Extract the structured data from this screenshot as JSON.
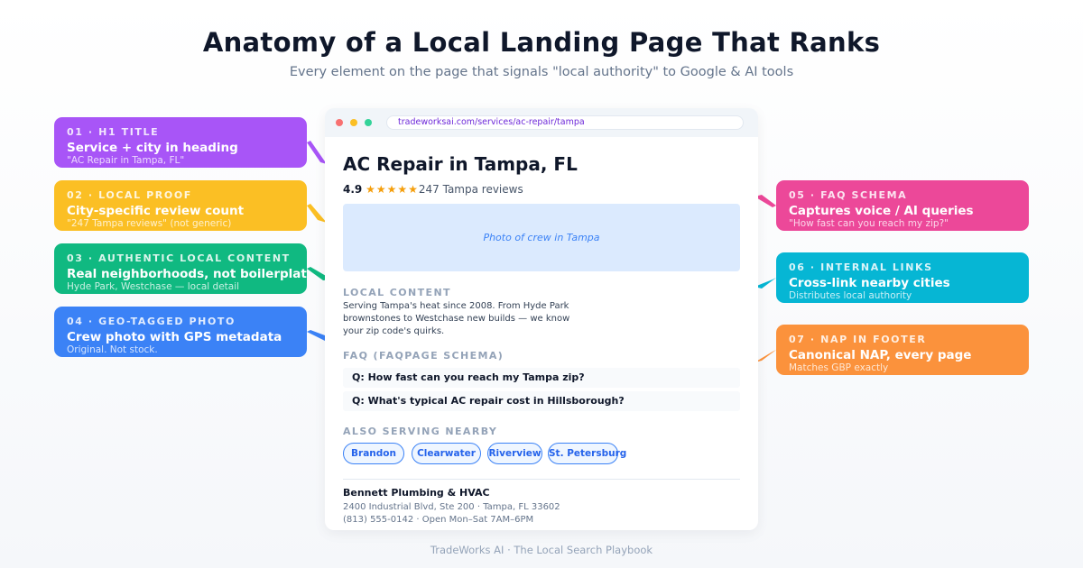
{
  "header": {
    "title": "Anatomy of a Local Landing Page That Ranks",
    "subtitle": "Every element on the page that signals \"local authority\" to Google & AI tools"
  },
  "callouts": [
    {
      "tag": "01 · H1 TITLE",
      "head": "Service + city in heading",
      "note": "\"AC Repair in Tampa, FL\"",
      "color": "#a855f7"
    },
    {
      "tag": "02 · LOCAL PROOF",
      "head": "City-specific review count",
      "note": "\"247 Tampa reviews\" (not generic)",
      "color": "#fbbf24"
    },
    {
      "tag": "03 · AUTHENTIC LOCAL CONTENT",
      "head": "Real neighborhoods, not boilerplate",
      "note": "Hyde Park, Westchase — local detail",
      "color": "#10b981"
    },
    {
      "tag": "04 · GEO-TAGGED PHOTO",
      "head": "Crew photo with GPS metadata",
      "note": "Original. Not stock.",
      "color": "#3b82f6"
    },
    {
      "tag": "05 · FAQ SCHEMA",
      "head": "Captures voice / AI queries",
      "note": "\"How fast can you reach my zip?\"",
      "color": "#ec4899"
    },
    {
      "tag": "06 · INTERNAL LINKS",
      "head": "Cross-link nearby cities",
      "note": "Distributes local authority",
      "color": "#06b6d4"
    },
    {
      "tag": "07 · NAP IN FOOTER",
      "head": "Canonical NAP, every page",
      "note": "Matches GBP exactly",
      "color": "#fb923c"
    }
  ],
  "browser": {
    "url": "tradeworksai.com/services/ac-repair/tampa",
    "dot_colors": [
      "#f87171",
      "#fbbf24",
      "#34d399"
    ],
    "h1": "AC Repair in Tampa, FL",
    "rating": {
      "value": "4.9",
      "stars": "★★★★★",
      "count": "247 Tampa reviews"
    },
    "photo_caption": "Photo of crew in Tampa",
    "local_content_label": "LOCAL CONTENT",
    "local_content_lines": [
      "Serving Tampa's heat since 2008. From Hyde Park",
      "brownstones to Westchase new builds — we know",
      "your zip code's quirks."
    ],
    "faq_label": "FAQ (FAQPAGE SCHEMA)",
    "faq_items": [
      "Q: How fast can you reach my Tampa zip?",
      "Q: What's typical AC repair cost in Hillsborough?"
    ],
    "nearby_label": "ALSO SERVING NEARBY",
    "nearby": [
      "Brandon",
      "Clearwater",
      "Riverview",
      "St. Petersburg"
    ],
    "nap": {
      "name": "Bennett Plumbing & HVAC",
      "address": "2400 Industrial Blvd, Ste 200 · Tampa, FL 33602",
      "phone_hours": "(813) 555-0142 · Open Mon–Sat 7AM–6PM"
    }
  },
  "footer": "TradeWorks AI · The Local Search Playbook"
}
